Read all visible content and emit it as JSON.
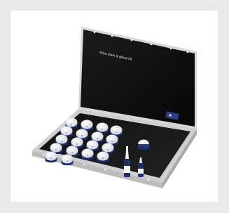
{
  "product": {
    "lid_title": "Miyo stain & glaze kit",
    "brand_mark": "ceramic brand logo"
  },
  "colors": {
    "background": "#e9e9e9",
    "card": "#ffffff",
    "lid_inside": "#0e0e0e",
    "box_edge": "#d9d9d9",
    "jar_cap": "#f0f0f2",
    "jar_band": "#2a3f86",
    "bottle_label": "#2a3f86"
  },
  "contents": {
    "jar_count": 18,
    "bottle_count": 2
  }
}
